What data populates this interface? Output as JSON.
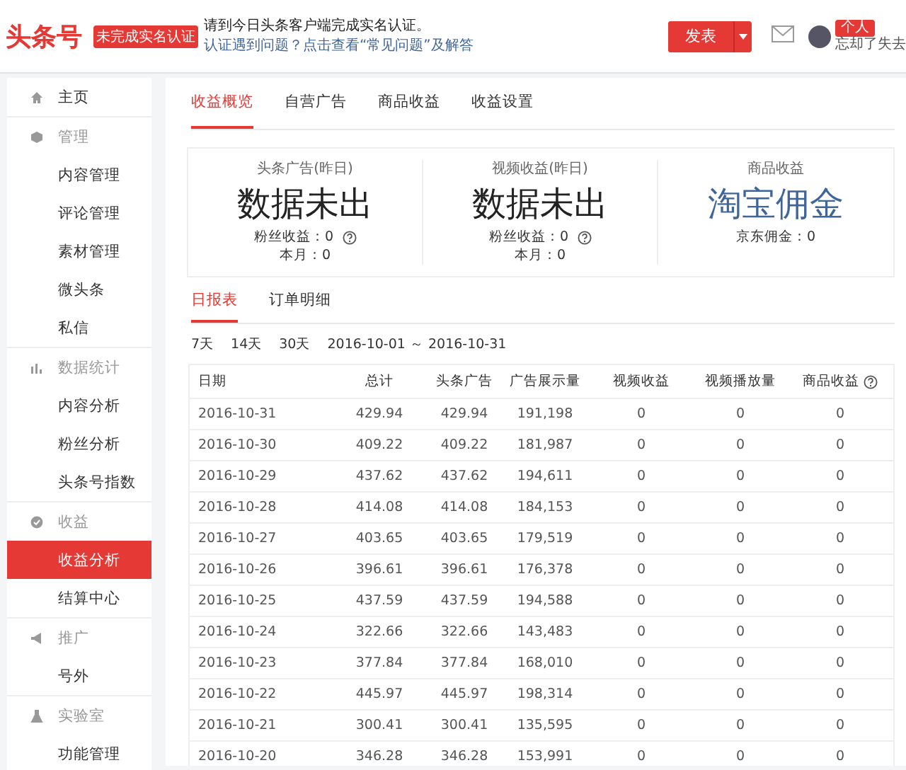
{
  "header": {
    "logo": "头条号",
    "badge": "未完成实名认证",
    "notice": "请到今日头条客户端完成实名认证。",
    "link": "认证遇到问题？点击查看“常见问题”及解答",
    "publish_button": "发表",
    "user_badge": "个人",
    "user_name": "忘却了失去"
  },
  "sidebar": {
    "items": [
      {
        "label": "主页",
        "kind": "top",
        "selected": false
      },
      {
        "label": "管理",
        "kind": "group",
        "selected": false,
        "children": [
          {
            "label": "内容管理",
            "selected": false
          },
          {
            "label": "评论管理",
            "selected": false
          },
          {
            "label": "素材管理",
            "selected": false
          },
          {
            "label": "微头条",
            "selected": false
          },
          {
            "label": "私信",
            "selected": false
          }
        ]
      },
      {
        "label": "数据统计",
        "kind": "group",
        "selected": false,
        "children": [
          {
            "label": "内容分析",
            "selected": false
          },
          {
            "label": "粉丝分析",
            "selected": false
          },
          {
            "label": "头条号指数",
            "selected": false
          }
        ]
      },
      {
        "label": "收益",
        "kind": "group",
        "selected": false,
        "children": [
          {
            "label": "收益分析",
            "selected": true
          },
          {
            "label": "结算中心",
            "selected": false
          }
        ]
      },
      {
        "label": "推广",
        "kind": "group",
        "selected": false,
        "children": [
          {
            "label": "号外",
            "selected": false
          }
        ]
      },
      {
        "label": "实验室",
        "kind": "group",
        "selected": false,
        "children": [
          {
            "label": "功能管理",
            "selected": false
          }
        ]
      }
    ]
  },
  "tabs": [
    {
      "label": "收益概览",
      "selected": true
    },
    {
      "label": "自营广告",
      "selected": false
    },
    {
      "label": "商品收益",
      "selected": false
    },
    {
      "label": "收益设置",
      "selected": false
    }
  ],
  "stats": [
    {
      "title": "头条广告(昨日)",
      "value": "数据未出",
      "kind": "plain",
      "lines": [
        "粉丝收益：0",
        "本月：0"
      ],
      "help": true
    },
    {
      "title": "视频收益(昨日)",
      "value": "数据未出",
      "kind": "plain",
      "lines": [
        "粉丝收益：0",
        "本月：0"
      ],
      "help": true
    },
    {
      "title": "商品收益",
      "value": "淘宝佣金",
      "kind": "link",
      "lines": [
        "京东佣金：0"
      ],
      "help": false
    }
  ],
  "sub_tabs": [
    {
      "label": "日报表",
      "selected": true
    },
    {
      "label": "订单明细",
      "selected": false
    }
  ],
  "filter": {
    "ranges": [
      "7天",
      "14天",
      "30天"
    ],
    "date_range": "2016-10-01 ～ 2016-10-31"
  },
  "table": {
    "columns": [
      {
        "label": "日期",
        "help": false
      },
      {
        "label": "总计",
        "help": false
      },
      {
        "label": "头条广告",
        "help": false
      },
      {
        "label": "广告展示量",
        "help": false
      },
      {
        "label": "视频收益",
        "help": false
      },
      {
        "label": "视频播放量",
        "help": false
      },
      {
        "label": "商品收益",
        "help": true
      }
    ],
    "rows": [
      [
        "2016-10-31",
        "429.94",
        "429.94",
        "191,198",
        "0",
        "0",
        "0"
      ],
      [
        "2016-10-30",
        "409.22",
        "409.22",
        "181,987",
        "0",
        "0",
        "0"
      ],
      [
        "2016-10-29",
        "437.62",
        "437.62",
        "194,611",
        "0",
        "0",
        "0"
      ],
      [
        "2016-10-28",
        "414.08",
        "414.08",
        "184,153",
        "0",
        "0",
        "0"
      ],
      [
        "2016-10-27",
        "403.65",
        "403.65",
        "179,519",
        "0",
        "0",
        "0"
      ],
      [
        "2016-10-26",
        "396.61",
        "396.61",
        "176,378",
        "0",
        "0",
        "0"
      ],
      [
        "2016-10-25",
        "437.59",
        "437.59",
        "194,588",
        "0",
        "0",
        "0"
      ],
      [
        "2016-10-24",
        "322.66",
        "322.66",
        "143,483",
        "0",
        "0",
        "0"
      ],
      [
        "2016-10-23",
        "377.84",
        "377.84",
        "168,010",
        "0",
        "0",
        "0"
      ],
      [
        "2016-10-22",
        "445.97",
        "445.97",
        "198,314",
        "0",
        "0",
        "0"
      ],
      [
        "2016-10-21",
        "300.41",
        "300.41",
        "135,595",
        "0",
        "0",
        "0"
      ],
      [
        "2016-10-20",
        "346.28",
        "346.28",
        "153,991",
        "0",
        "0",
        "0"
      ]
    ]
  }
}
